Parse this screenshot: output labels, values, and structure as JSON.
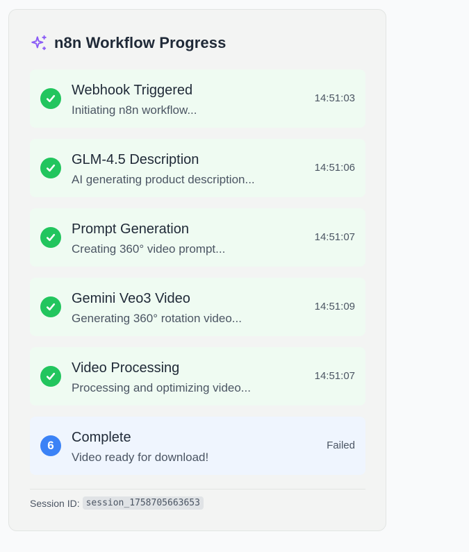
{
  "header": {
    "title": "n8n Workflow Progress",
    "icon": "sparkles-icon",
    "icon_color": "#8b5cf6"
  },
  "steps": [
    {
      "name": "Webhook Triggered",
      "description": "Initiating n8n workflow...",
      "time": "14:51:03",
      "status": "complete",
      "icon": "check-icon"
    },
    {
      "name": "GLM-4.5 Description",
      "description": "AI generating product description...",
      "time": "14:51:06",
      "status": "complete",
      "icon": "check-icon"
    },
    {
      "name": "Prompt Generation",
      "description": "Creating 360° video prompt...",
      "time": "14:51:07",
      "status": "complete",
      "icon": "check-icon"
    },
    {
      "name": "Gemini Veo3 Video",
      "description": "Generating 360° rotation video...",
      "time": "14:51:09",
      "status": "complete",
      "icon": "check-icon"
    },
    {
      "name": "Video Processing",
      "description": "Processing and optimizing video...",
      "time": "14:51:07",
      "status": "complete",
      "icon": "check-icon"
    },
    {
      "name": "Complete",
      "description": "Video ready for download!",
      "time": "Failed",
      "status": "pending",
      "number": "6"
    }
  ],
  "footer": {
    "session_label": "Session ID:",
    "session_id": "session_1758705663653"
  },
  "colors": {
    "complete_badge": "#22c55e",
    "pending_badge": "#3b82f6",
    "complete_bg": "#effbf2",
    "pending_bg": "#eff5fe"
  }
}
